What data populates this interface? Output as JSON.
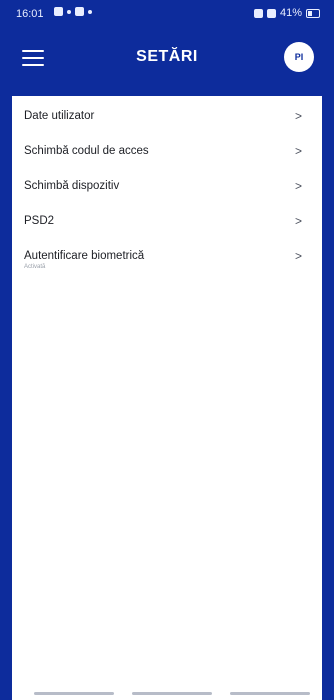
{
  "status_bar": {
    "time": "16:01",
    "battery": "41%"
  },
  "app_bar": {
    "title": "SETĂRI",
    "avatar_initials": "PI"
  },
  "settings_items": [
    {
      "label": "Date utilizator"
    },
    {
      "label": "Schimbă codul de acces"
    },
    {
      "label": "Schimbă dispozitiv"
    },
    {
      "label": "PSD2"
    },
    {
      "label": "Autentificare biometrică",
      "sub": "Activată"
    }
  ],
  "icons": {
    "menu": "hamburger-menu-icon",
    "chevron": "chevron-right-icon"
  },
  "colors": {
    "primary": "#0d2c9c",
    "background": "#ffffff"
  }
}
